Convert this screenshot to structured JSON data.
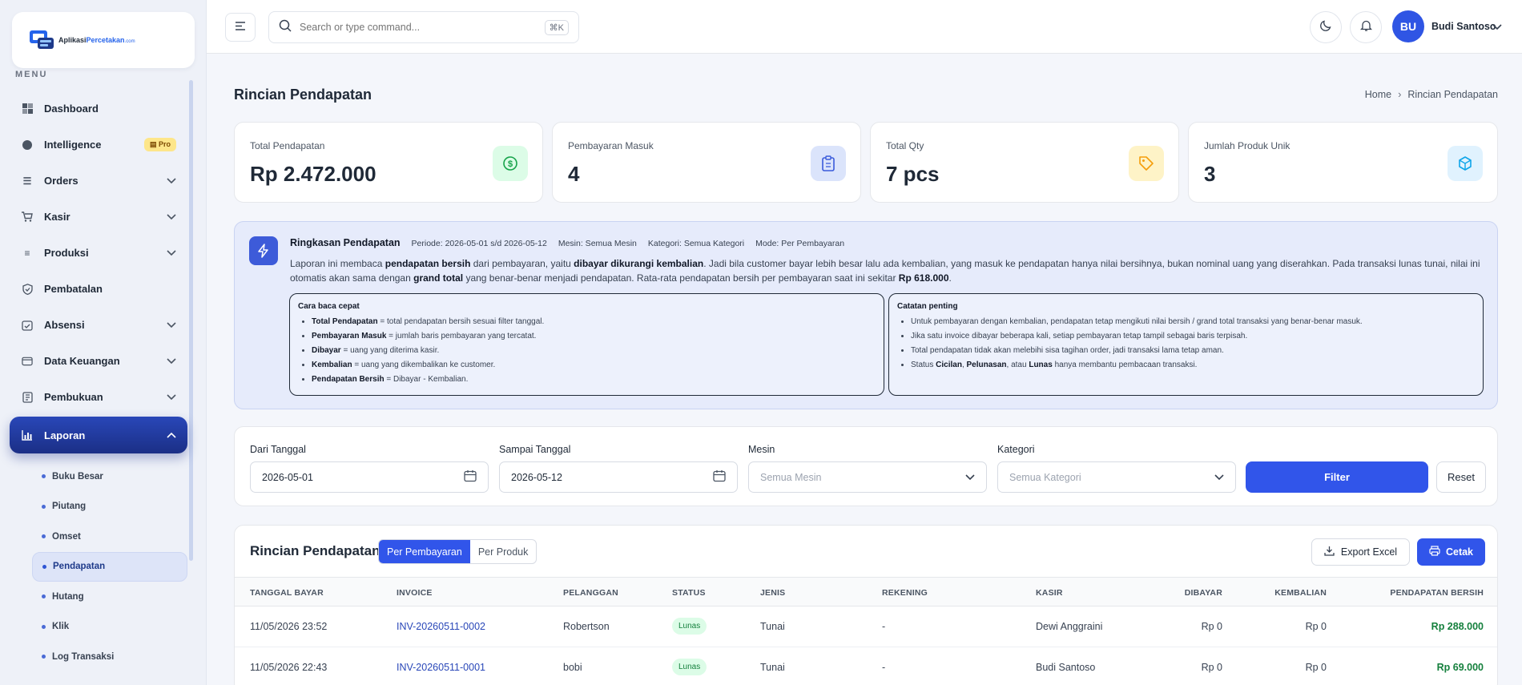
{
  "app": {
    "logo_name": "Aplikasi",
    "logo_accent": "Percetakan",
    "logo_suffix": ".com"
  },
  "sidebar": {
    "menu_label": "MENU",
    "items": [
      {
        "label": "Dashboard",
        "icon": "dashboard-icon"
      },
      {
        "label": "Intelligence",
        "icon": "brain-icon",
        "badge": "Pro"
      },
      {
        "label": "Orders",
        "icon": "orders-icon"
      },
      {
        "label": "Kasir",
        "icon": "cart-icon"
      },
      {
        "label": "Produksi",
        "icon": "production-icon"
      },
      {
        "label": "Pembatalan",
        "icon": "shield-icon"
      },
      {
        "label": "Absensi",
        "icon": "calendar-check-icon"
      },
      {
        "label": "Data Keuangan",
        "icon": "wallet-icon"
      },
      {
        "label": "Pembukuan",
        "icon": "book-icon"
      },
      {
        "label": "Laporan",
        "icon": "chart-icon"
      }
    ],
    "sub_items": [
      {
        "label": "Buku Besar"
      },
      {
        "label": "Piutang"
      },
      {
        "label": "Omset"
      },
      {
        "label": "Pendapatan"
      },
      {
        "label": "Hutang"
      },
      {
        "label": "Klik"
      },
      {
        "label": "Log Transaksi"
      }
    ]
  },
  "topbar": {
    "search_placeholder": "Search or type command...",
    "search_shortcut": "⌘K",
    "avatar_initials": "BU",
    "user_name": "Budi Santoso"
  },
  "page": {
    "title": "Rincian Pendapatan",
    "breadcrumb": [
      "Home",
      "Rincian Pendapatan"
    ]
  },
  "stats": [
    {
      "label": "Total Pendapatan",
      "value": "Rp 2.472.000",
      "icon": "dollar-icon",
      "color": "#16a34a",
      "bg": "#dcfce7"
    },
    {
      "label": "Pembayaran Masuk",
      "value": "4",
      "icon": "clipboard-icon",
      "color": "#3b5bdb",
      "bg": "#dbe4fb"
    },
    {
      "label": "Total Qty",
      "value": "7 pcs",
      "icon": "tag-icon",
      "color": "#f59e0b",
      "bg": "#fef3c7"
    },
    {
      "label": "Jumlah Produk Unik",
      "value": "3",
      "icon": "box-icon",
      "color": "#0ea5e9",
      "bg": "#e0f2fe"
    }
  ],
  "summary": {
    "title": "Ringkasan Pendapatan",
    "periode": "Periode: 2026-05-01 s/d 2026-05-12",
    "mesin": "Mesin: Semua Mesin",
    "kategori": "Kategori: Semua Kategori",
    "mode": "Mode: Per Pembayaran",
    "para_1": "Laporan ini membaca ",
    "para_b1": "pendapatan bersih",
    "para_2": " dari pembayaran, yaitu ",
    "para_b2": "dibayar dikurangi kembalian",
    "para_3": ". Jadi bila customer bayar lebih besar lalu ada kembalian, yang masuk ke pendapatan hanya nilai bersihnya, bukan nominal uang yang diserahkan. Pada transaksi lunas tunai, nilai ini otomatis akan sama dengan ",
    "para_b3": "grand total",
    "para_4": " yang benar-benar menjadi pendapatan. Rata-rata pendapatan bersih per pembayaran saat ini sekitar ",
    "para_b4": "Rp 618.000",
    "para_5": ".",
    "cara_title": "Cara baca cepat",
    "cara": [
      {
        "b": "Total Pendapatan",
        "t": " = total pendapatan bersih sesuai filter tanggal."
      },
      {
        "b": "Pembayaran Masuk",
        "t": " = jumlah baris pembayaran yang tercatat."
      },
      {
        "b": "Dibayar",
        "t": " = uang yang diterima kasir."
      },
      {
        "b": "Kembalian",
        "t": " = uang yang dikembalikan ke customer."
      },
      {
        "b": "Pendapatan Bersih",
        "t": " = Dibayar - Kembalian."
      }
    ],
    "catatan_title": "Catatan penting",
    "catatan": [
      "Untuk pembayaran dengan kembalian, pendapatan tetap mengikuti nilai bersih / grand total transaksi yang benar-benar masuk.",
      "Jika satu invoice dibayar beberapa kali, setiap pembayaran tetap tampil sebagai baris terpisah.",
      "Total pendapatan tidak akan melebihi sisa tagihan order, jadi transaksi lama tetap aman."
    ],
    "catatan_last_1": "Status ",
    "catatan_last_b1": "Cicilan",
    "catatan_last_2": ", ",
    "catatan_last_b2": "Pelunasan",
    "catatan_last_3": ", atau ",
    "catatan_last_b3": "Lunas",
    "catatan_last_4": " hanya membantu pembacaan transaksi."
  },
  "filter": {
    "dari_label": "Dari Tanggal",
    "dari_value": "2026-05-01",
    "sampai_label": "Sampai Tanggal",
    "sampai_value": "2026-05-12",
    "mesin_label": "Mesin",
    "mesin_value": "Semua Mesin",
    "kategori_label": "Kategori",
    "kategori_value": "Semua Kategori",
    "filter_button": "Filter",
    "reset_button": "Reset"
  },
  "table": {
    "title": "Rincian Pendapatan",
    "tab_per_pembayaran": "Per Pembayaran",
    "tab_per_produk": "Per Produk",
    "export_label": "Export Excel",
    "cetak_label": "Cetak",
    "headers": [
      "TANGGAL BAYAR",
      "INVOICE",
      "PELANGGAN",
      "STATUS",
      "JENIS",
      "REKENING",
      "KASIR",
      "DIBAYAR",
      "KEMBALIAN",
      "PENDAPATAN BERSIH"
    ],
    "rows": [
      {
        "tanggal": "11/05/2026 23:52",
        "invoice": "INV-20260511-0002",
        "pelanggan": "Robertson",
        "status": "Lunas",
        "jenis": "Tunai",
        "rekening": "-",
        "kasir": "Dewi Anggraini",
        "dibayar": "Rp 0",
        "kembalian": "Rp 0",
        "bersih": "Rp 288.000"
      },
      {
        "tanggal": "11/05/2026 22:43",
        "invoice": "INV-20260511-0001",
        "pelanggan": "bobi",
        "status": "Lunas",
        "jenis": "Tunai",
        "rekening": "-",
        "kasir": "Budi Santoso",
        "dibayar": "Rp 0",
        "kembalian": "Rp 0",
        "bersih": "Rp 69.000"
      }
    ]
  }
}
